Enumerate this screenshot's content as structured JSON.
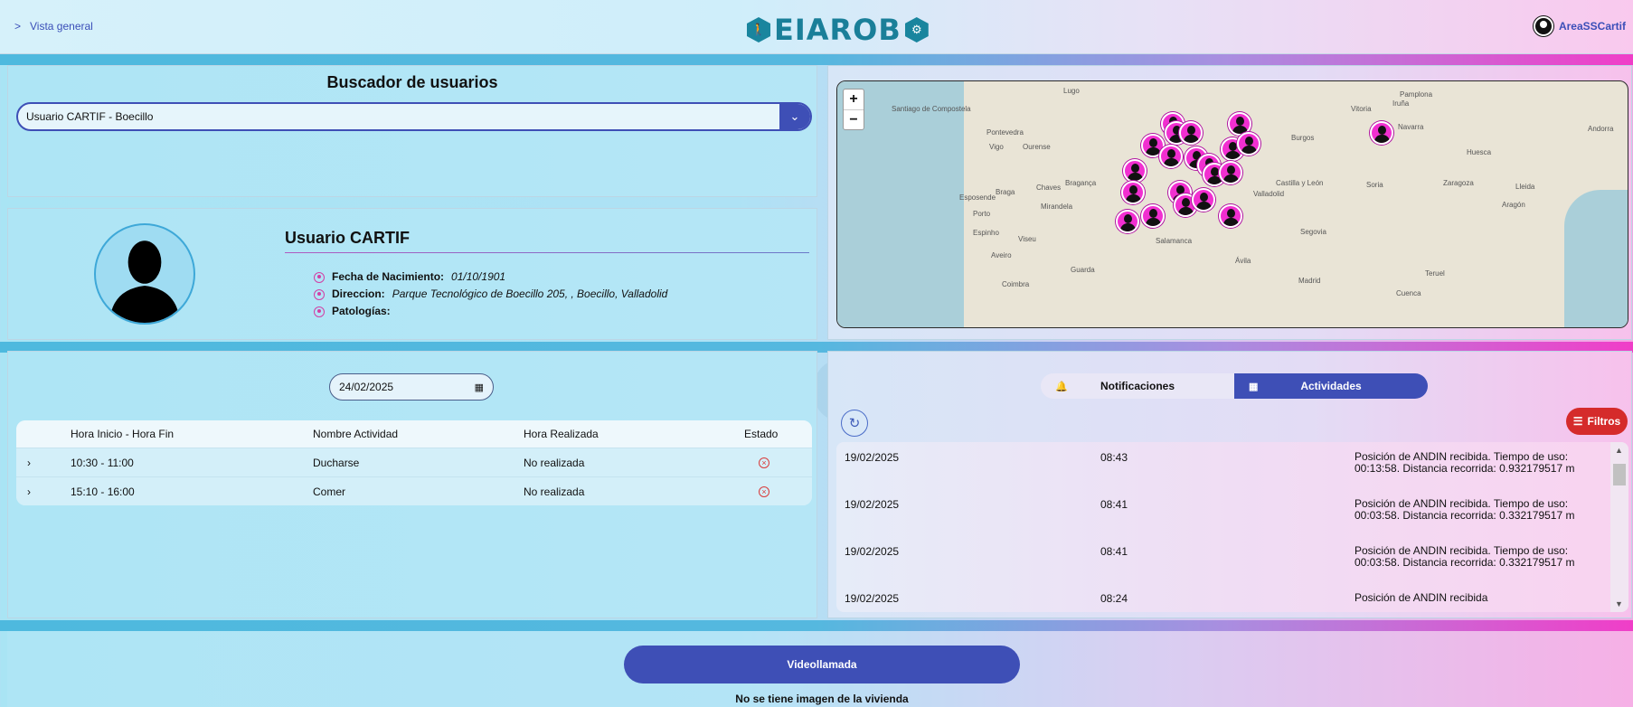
{
  "header": {
    "breadcrumb": "Vista general",
    "logo_text": "EIAROB",
    "user": "AreaSSCartif"
  },
  "search": {
    "title": "Buscador de usuarios",
    "selected": "Usuario CARTIF - Boecillo"
  },
  "profile": {
    "name": "Usuario CARTIF",
    "fields": [
      {
        "label": "Fecha de Nacimiento:",
        "value": "01/10/1901"
      },
      {
        "label": "Direccion:",
        "value": "Parque Tecnológico de Boecillo 205, , Boecillo, Valladolid"
      },
      {
        "label": "Patologías:",
        "value": ""
      }
    ]
  },
  "activities": {
    "date": "24/02/2025",
    "headers": [
      "Hora Inicio - Hora Fin",
      "Nombre Actividad",
      "Hora Realizada",
      "Estado"
    ],
    "rows": [
      {
        "time": "10:30 - 11:00",
        "name": "Ducharse",
        "done": "No realizada",
        "status": "not-done"
      },
      {
        "time": "15:10 - 16:00",
        "name": "Comer",
        "done": "No realizada",
        "status": "not-done"
      }
    ]
  },
  "map": {
    "zoom_in": "+",
    "zoom_out": "−",
    "labels": [
      "Santiago de Compostela",
      "Lugo",
      "Ourense",
      "Pontevedra",
      "Vigo",
      "Braga",
      "Porto",
      "Aveiro",
      "Coimbra",
      "Guarda",
      "Salamanca",
      "Valladolid",
      "Burgos",
      "Pamplona",
      "Zaragoza",
      "Lleida",
      "Huesca",
      "Soria",
      "Segovia",
      "Ávila",
      "Madrid",
      "Teruel",
      "Cuenca",
      "Bragança",
      "Chaves",
      "Mirandela",
      "Viseu",
      "Vitoria",
      "Iruña",
      "Andorra",
      "Castilla y León",
      "Aragón",
      "Navarra",
      "Esposende",
      "Espinho"
    ]
  },
  "notifications": {
    "tab_notifications": "Notificaciones",
    "tab_activities": "Actividades",
    "active_tab": "Actividades",
    "filters_label": "Filtros",
    "items": [
      {
        "date": "19/02/2025",
        "time": "08:43",
        "message": "Posición de ANDIN recibida. Tiempo de uso: 00:13:58. Distancia recorrida: 0.932179517 m"
      },
      {
        "date": "19/02/2025",
        "time": "08:41",
        "message": "Posición de ANDIN recibida. Tiempo de uso: 00:03:58. Distancia recorrida: 0.332179517 m"
      },
      {
        "date": "19/02/2025",
        "time": "08:41",
        "message": "Posición de ANDIN recibida. Tiempo de uso: 00:03:58. Distancia recorrida: 0.332179517 m"
      },
      {
        "date": "19/02/2025",
        "time": "08:24",
        "message": "Posición de ANDIN recibida"
      }
    ]
  },
  "footer": {
    "video_button": "Videollamada",
    "no_image": "No se tiene imagen de la vivienda"
  },
  "colors": {
    "accent": "#3e4fb6",
    "pin": "#f12fd0",
    "danger": "#d52b2b"
  }
}
